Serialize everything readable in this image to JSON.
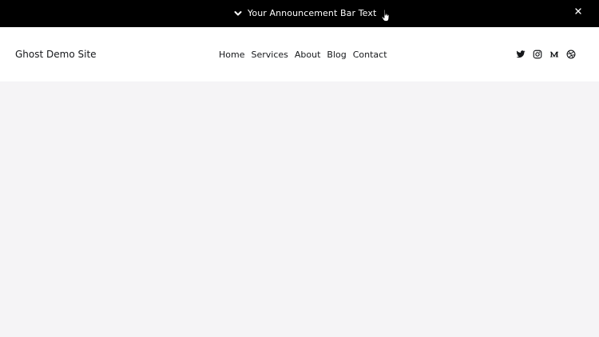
{
  "announcement": {
    "text": "Your Announcement Bar Text",
    "toggle_icon": "chevron-down-icon",
    "close_icon": "close-icon"
  },
  "header": {
    "site_title": "Ghost Demo Site",
    "nav": [
      {
        "label": "Home"
      },
      {
        "label": "Services"
      },
      {
        "label": "About"
      },
      {
        "label": "Blog"
      },
      {
        "label": "Contact"
      }
    ],
    "social": [
      {
        "icon": "twitter-icon"
      },
      {
        "icon": "instagram-icon"
      },
      {
        "icon": "medium-icon"
      },
      {
        "icon": "dribbble-icon"
      }
    ]
  },
  "colors": {
    "announcement_bg": "#000000",
    "announcement_text": "#ffffff",
    "header_bg": "#ffffff",
    "text": "#15171a",
    "page_bg": "#f5f4f6"
  }
}
